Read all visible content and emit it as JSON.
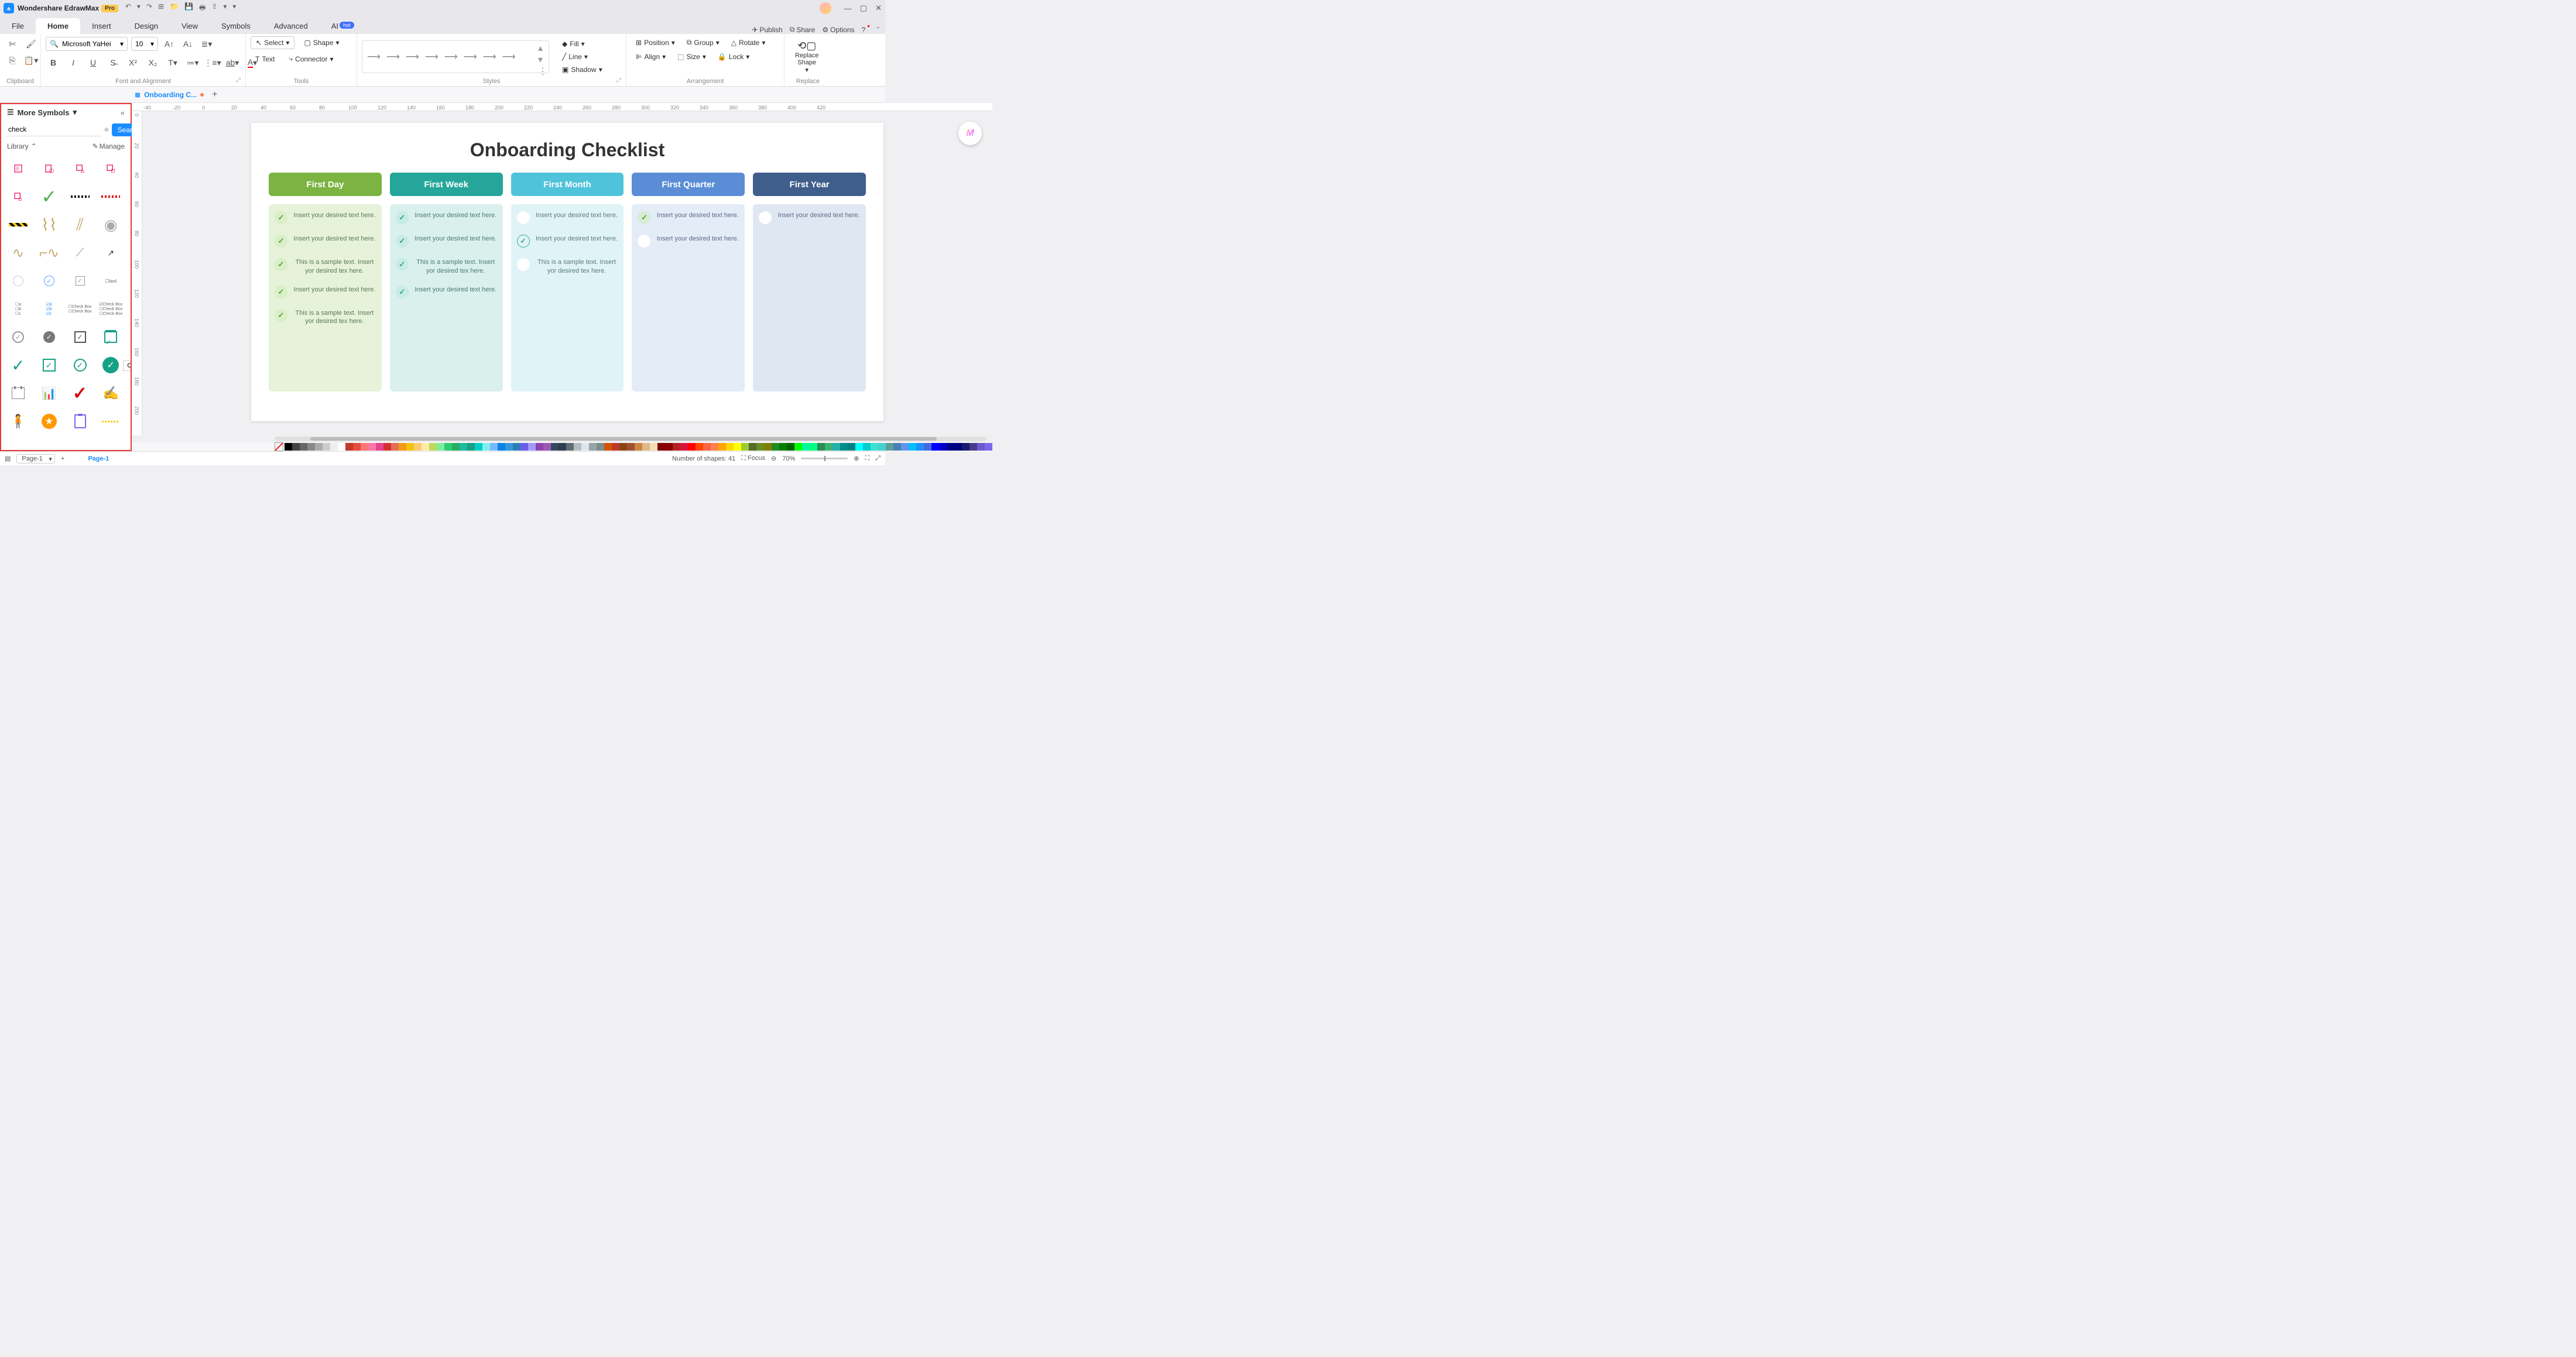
{
  "app": {
    "title": "Wondershare EdrawMax",
    "edition": "Pro"
  },
  "menus": [
    "File",
    "Home",
    "Insert",
    "Design",
    "View",
    "Symbols",
    "Advanced",
    "AI"
  ],
  "menu_ai_badge": "hot",
  "active_menu": "Home",
  "right_menus": {
    "publish": "Publish",
    "share": "Share",
    "options": "Options"
  },
  "ribbon": {
    "clipboard_label": "Clipboard",
    "font_label": "Font and Alignment",
    "tools_label": "Tools",
    "styles_label": "Styles",
    "arrangement_label": "Arrangement",
    "replace_label": "Replace",
    "font_name": "Microsoft YaHei",
    "font_size": "10",
    "select_btn": "Select",
    "shape_btn": "Shape",
    "text_btn": "Text",
    "connector_btn": "Connector",
    "fill_btn": "Fill",
    "line_btn": "Line",
    "shadow_btn": "Shadow",
    "position_btn": "Position",
    "align_btn": "Align",
    "group_btn": "Group",
    "size_btn": "Size",
    "rotate_btn": "Rotate",
    "lock_btn": "Lock",
    "replace_shape_btn": "Replace\nShape"
  },
  "doc_tab": {
    "title": "Onboarding C...",
    "modified": true
  },
  "panel": {
    "title": "More Symbols",
    "search_value": "check",
    "search_btn": "Search",
    "library_label": "Library",
    "manage_label": "Manage",
    "tooltip_text": "Check"
  },
  "ruler_h": [
    "-40",
    "-20",
    "0",
    "20",
    "40",
    "60",
    "80",
    "100",
    "120",
    "140",
    "160",
    "180",
    "200",
    "220",
    "240",
    "260",
    "280",
    "300",
    "320",
    "340",
    "360",
    "380",
    "400",
    "420"
  ],
  "ruler_v": [
    "0",
    "20",
    "40",
    "60",
    "80",
    "100",
    "120",
    "140",
    "160",
    "180",
    "200"
  ],
  "document": {
    "title": "Onboarding Checklist",
    "columns": [
      {
        "head": "First Day",
        "items": [
          {
            "text": "Insert your desired text here.",
            "check": "green"
          },
          {
            "text": "Insert your desired text here.",
            "check": "green"
          },
          {
            "text": "This is a sample text. Insert yor desired tex here.",
            "check": "green"
          },
          {
            "text": "Insert your desired text here.",
            "check": "green"
          },
          {
            "text": "This is a sample text. Insert yor desired tex here.",
            "check": "green"
          }
        ]
      },
      {
        "head": "First Week",
        "items": [
          {
            "text": "Insert your desired text here.",
            "check": "teal"
          },
          {
            "text": "Insert your desired text here.",
            "check": "teal"
          },
          {
            "text": "This is a sample text. Insert yor desired tex here.",
            "check": "teal"
          },
          {
            "text": "Insert your desired text here.",
            "check": "teal"
          }
        ]
      },
      {
        "head": "First Month",
        "items": [
          {
            "text": "Insert your desired text here.",
            "check": "white"
          },
          {
            "text": "Insert your desired text here.",
            "check": "tealv"
          },
          {
            "text": "This is a sample text. Insert yor desired tex here.",
            "check": "white"
          }
        ]
      },
      {
        "head": "First Quarter",
        "items": [
          {
            "text": "Insert your desired text here.",
            "check": "blue"
          },
          {
            "text": "Insert your desired text here.",
            "check": "white"
          }
        ]
      },
      {
        "head": "First Year",
        "items": [
          {
            "text": "Insert your desired text here.",
            "check": "white"
          }
        ]
      }
    ]
  },
  "colors": [
    "#000",
    "#444",
    "#666",
    "#888",
    "#aaa",
    "#ccc",
    "#eee",
    "#fff",
    "#c0392b",
    "#e74c3c",
    "#ff7675",
    "#fd79a8",
    "#e84393",
    "#d63031",
    "#e17055",
    "#f39c12",
    "#f1c40f",
    "#fdcb6e",
    "#ffeaa7",
    "#badc58",
    "#7bed9f",
    "#2ecc71",
    "#27ae60",
    "#1abc9c",
    "#16a085",
    "#00cec9",
    "#81ecec",
    "#74b9ff",
    "#0984e3",
    "#3498db",
    "#2980b9",
    "#6c5ce7",
    "#a29bfe",
    "#8e44ad",
    "#9b59b6",
    "#34495e",
    "#2c3e50",
    "#636e72",
    "#b2bec3",
    "#dfe6e9",
    "#95a5a6",
    "#7f8c8d",
    "#d35400",
    "#c0392b",
    "#8b4513",
    "#a0522d",
    "#cd853f",
    "#deb887",
    "#f5deb3",
    "#800000",
    "#8b0000",
    "#b22222",
    "#dc143c",
    "#ff0000",
    "#ff4500",
    "#ff6347",
    "#ff7f50",
    "#ffa500",
    "#ffd700",
    "#ffff00",
    "#9acd32",
    "#556b2f",
    "#6b8e23",
    "#808000",
    "#228b22",
    "#008000",
    "#006400",
    "#00ff00",
    "#00fa9a",
    "#00ff7f",
    "#2e8b57",
    "#3cb371",
    "#20b2aa",
    "#008b8b",
    "#008080",
    "#00ffff",
    "#00ced1",
    "#40e0d0",
    "#48d1cc",
    "#5f9ea0",
    "#4682b4",
    "#6495ed",
    "#00bfff",
    "#1e90ff",
    "#4169e1",
    "#0000ff",
    "#0000cd",
    "#00008b",
    "#000080",
    "#191970",
    "#483d8b",
    "#6a5acd",
    "#7b68ee"
  ],
  "status": {
    "page_label": "Page-1",
    "page_name": "Page-1",
    "shapes_count": "Number of shapes: 41",
    "focus_label": "Focus",
    "zoom_label": "70%"
  }
}
